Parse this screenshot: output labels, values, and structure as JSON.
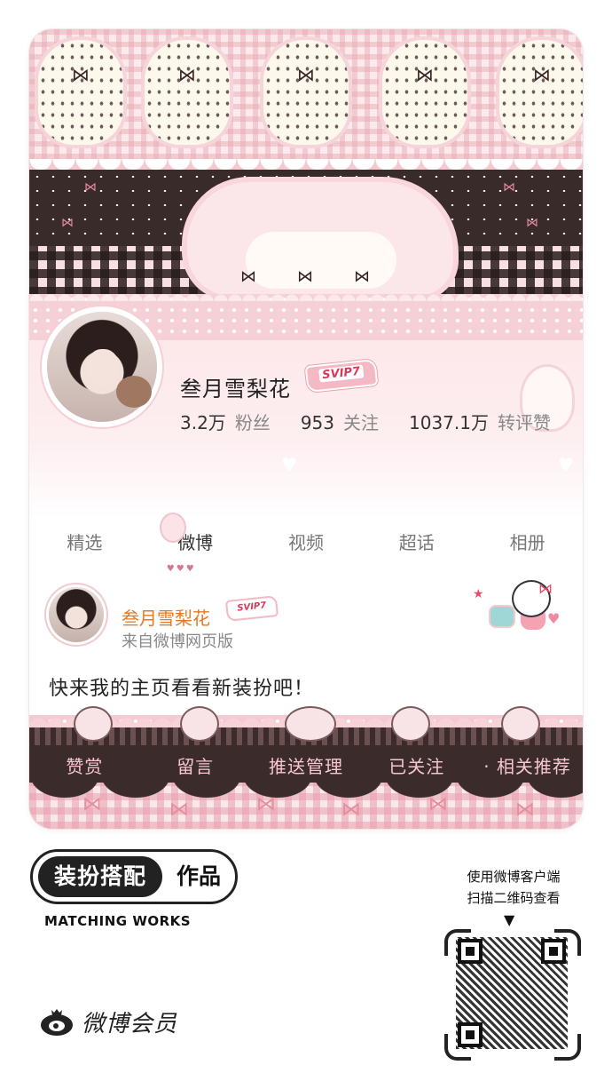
{
  "profile": {
    "name": "叁月雪梨花",
    "vip_badge": "SVIP7",
    "followers_count": "3.2万",
    "followers_label": "粉丝",
    "following_count": "953",
    "following_label": "关注",
    "likes_count": "1037.1万",
    "likes_label": "转评赞"
  },
  "tabs": [
    {
      "label": "精选",
      "active": false
    },
    {
      "label": "微博",
      "active": true
    },
    {
      "label": "视频",
      "active": false
    },
    {
      "label": "超话",
      "active": false
    },
    {
      "label": "相册",
      "active": false
    }
  ],
  "post": {
    "author": "叁月雪梨花",
    "vip_badge": "SVIP7",
    "source": "来自微博网页版",
    "text": "快来我的主页看看新装扮吧！"
  },
  "actions": [
    {
      "label": "赞赏"
    },
    {
      "label": "留言"
    },
    {
      "label": "推送管理"
    },
    {
      "label": "已关注"
    },
    {
      "label": "相关推荐"
    }
  ],
  "branding": {
    "badge_dark": "装扮搭配",
    "badge_light": "作品",
    "subtitle": "MATCHING WORKS",
    "logo_text": "微博会员",
    "scan_line1": "使用微博客户端",
    "scan_line2": "扫描二维码查看"
  },
  "colors": {
    "accent_orange": "#e8771e",
    "theme_pink": "#f5c9d1",
    "theme_dark": "#3b2b2b"
  }
}
